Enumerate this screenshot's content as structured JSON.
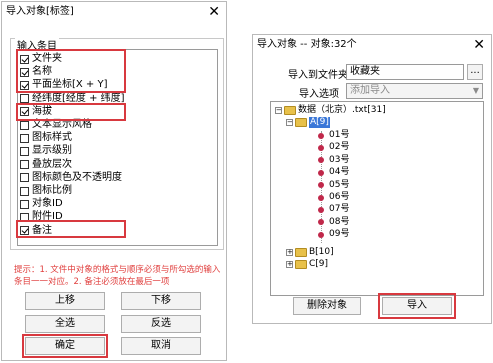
{
  "left_dialog": {
    "title": "导入对象[标签]",
    "close": "✕",
    "group_label": "输入条目",
    "items": [
      {
        "label": "文件夹",
        "checked": true
      },
      {
        "label": "名称",
        "checked": true
      },
      {
        "label": "平面坐标[X + Y]",
        "checked": true
      },
      {
        "label": "经纬度[经度 + 纬度]",
        "checked": false
      },
      {
        "label": "海拔",
        "checked": true
      },
      {
        "label": "文本显示风格",
        "checked": false
      },
      {
        "label": "图标样式",
        "checked": false
      },
      {
        "label": "显示级别",
        "checked": false
      },
      {
        "label": "叠放层次",
        "checked": false
      },
      {
        "label": "图标颜色及不透明度",
        "checked": false
      },
      {
        "label": "图标比例",
        "checked": false
      },
      {
        "label": "对象ID",
        "checked": false
      },
      {
        "label": "附件ID",
        "checked": false
      },
      {
        "label": "备注",
        "checked": true
      }
    ],
    "hint": "提示：1. 文件中对象的格式与顺序必须与所勾选的输入条目一一对应。2. 备注必须放在最后一项",
    "buttons": {
      "up": "上移",
      "down": "下移",
      "select_all": "全选",
      "invert": "反选",
      "ok": "确定",
      "cancel": "取消"
    },
    "highlight_color": "#d8393f"
  },
  "right_dialog": {
    "title": "导入对象 -- 对象:32个",
    "close": "✕",
    "folder_label": "导入到文件夹",
    "folder_value": "收藏夹",
    "browse": "...",
    "option_label": "导入选项",
    "option_value": "添加导入",
    "tree": {
      "root": "数据（北京）.txt[31]",
      "selected": "A[9]",
      "leaves": [
        "01号",
        "02号",
        "03号",
        "04号",
        "05号",
        "06号",
        "07号",
        "08号",
        "09号"
      ],
      "others": [
        "B[10]",
        "C[9]"
      ]
    },
    "buttons": {
      "delete": "删除对象",
      "import": "导入"
    }
  }
}
